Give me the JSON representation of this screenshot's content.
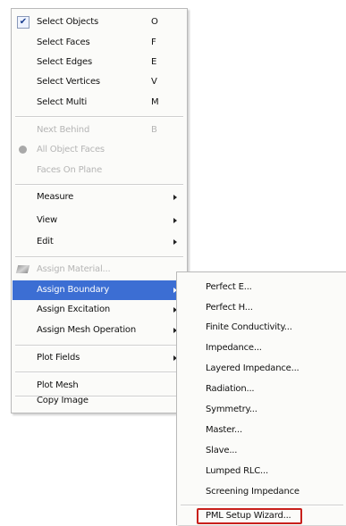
{
  "main_menu": {
    "select_objects": {
      "label": "Select Objects",
      "key": "O",
      "checked": true
    },
    "select_faces": {
      "label": "Select Faces",
      "key": "F"
    },
    "select_edges": {
      "label": "Select Edges",
      "key": "E"
    },
    "select_vertices": {
      "label": "Select Vertices",
      "key": "V"
    },
    "select_multi": {
      "label": "Select Multi",
      "key": "M"
    },
    "next_behind": {
      "label": "Next Behind",
      "key": "B"
    },
    "all_object_faces": {
      "label": "All Object Faces"
    },
    "faces_on_plane": {
      "label": "Faces On Plane"
    },
    "measure": {
      "label": "Measure"
    },
    "view": {
      "label": "View"
    },
    "edit": {
      "label": "Edit"
    },
    "assign_material": {
      "label": "Assign Material..."
    },
    "assign_boundary": {
      "label": "Assign Boundary"
    },
    "assign_excitation": {
      "label": "Assign Excitation"
    },
    "assign_mesh_operation": {
      "label": "Assign Mesh Operation"
    },
    "plot_fields": {
      "label": "Plot Fields"
    },
    "plot_mesh": {
      "label": "Plot Mesh"
    },
    "copy_image": {
      "label": "Copy Image"
    }
  },
  "submenu": {
    "perfect_e": "Perfect E...",
    "perfect_h": "Perfect H...",
    "finite_conductivity": "Finite Conductivity...",
    "impedance": "Impedance...",
    "layered_impedance": "Layered Impedance...",
    "radiation": "Radiation...",
    "symmetry": "Symmetry...",
    "master": "Master...",
    "slave": "Slave...",
    "lumped_rlc": "Lumped RLC...",
    "screening_impedance": "Screening Impedance",
    "pml_setup_wizard": "PML Setup Wizard..."
  },
  "colors": {
    "highlight": "#3c6ed3",
    "annotation_box": "#c8201c"
  }
}
